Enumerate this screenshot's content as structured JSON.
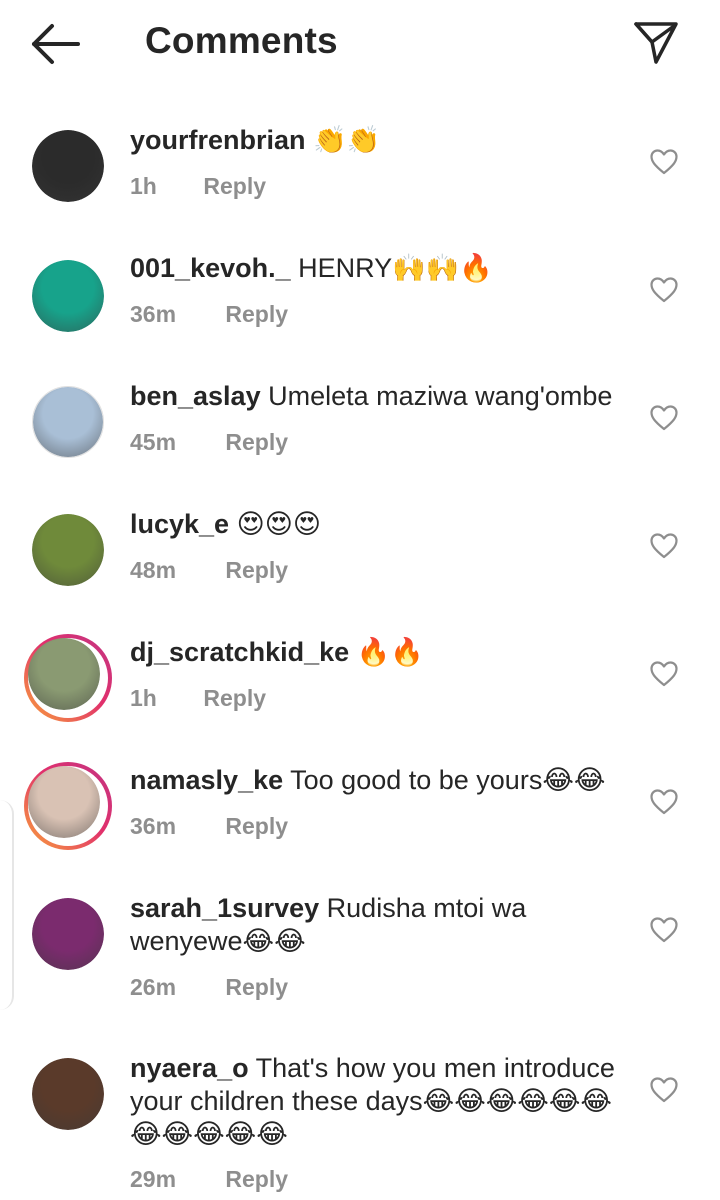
{
  "header": {
    "title": "Comments",
    "back_icon": "arrow-left-icon",
    "share_icon": "paper-plane-icon"
  },
  "reply_label": "Reply",
  "comments": [
    {
      "user": "yourfrenbrian",
      "text": "👏👏",
      "time": "1h",
      "story_ring": false,
      "avatar_color": "#2b2b2b"
    },
    {
      "user": "001_kevoh._",
      "text": "HENRY🙌🙌🔥",
      "time": "36m",
      "story_ring": false,
      "avatar_color": "#17a38b"
    },
    {
      "user": "ben_aslay",
      "text": "Umeleta maziwa wang'ombe",
      "time": "45m",
      "story_ring": false,
      "avatar_color": "#a9bfd6"
    },
    {
      "user": "lucyk_e",
      "text": "😍😍😍",
      "time": "48m",
      "story_ring": false,
      "avatar_color": "#6f8a3a"
    },
    {
      "user": "dj_scratchkid_ke",
      "text": "🔥🔥",
      "time": "1h",
      "story_ring": true,
      "avatar_color": "#8a9a72"
    },
    {
      "user": "namasly_ke",
      "text": "Too good to be yours😂😂",
      "time": "36m",
      "story_ring": true,
      "avatar_color": "#d9c2b4"
    },
    {
      "user": "sarah_1survey",
      "text": "Rudisha mtoi wa wenyewe😂😂",
      "time": "26m",
      "story_ring": false,
      "avatar_color": "#7b2b6e"
    },
    {
      "user": "nyaera_o",
      "text": "That's how you men introduce your children these days😂😂😂😂😂😂😂😂😂😂😂",
      "time": "29m",
      "story_ring": false,
      "avatar_color": "#5a3a2a"
    }
  ],
  "colors": {
    "text": "#262626",
    "meta": "#8e8e8e",
    "story_ring_start": "#f9a43a",
    "story_ring_end": "#c13584"
  }
}
